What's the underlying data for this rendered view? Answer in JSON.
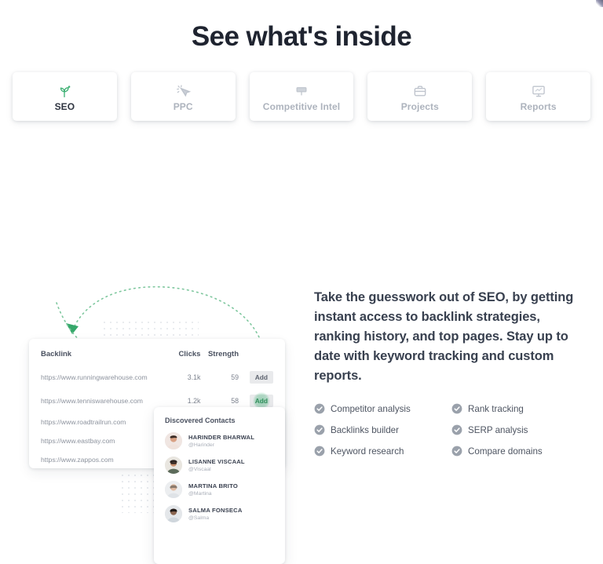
{
  "header": {
    "title": "See what's inside"
  },
  "tabs": [
    {
      "label": "SEO",
      "icon": "sprout-icon",
      "active": true
    },
    {
      "label": "PPC",
      "icon": "cursor-click-icon",
      "active": false
    },
    {
      "label": "Competitive Intel",
      "icon": "flag-icon",
      "active": false
    },
    {
      "label": "Projects",
      "icon": "briefcase-icon",
      "active": false
    },
    {
      "label": "Reports",
      "icon": "monitor-chart-icon",
      "active": false
    }
  ],
  "backlink_table": {
    "columns": [
      "Backlink",
      "Clicks",
      "Strength",
      ""
    ],
    "rows": [
      {
        "backlink": "https://www.runningwarehouse.com",
        "clicks": "3.1k",
        "strength": "59",
        "action": "Add",
        "action_state": "default"
      },
      {
        "backlink": "https://www.tenniswarehouse.com",
        "clicks": "1.2k",
        "strength": "58",
        "action": "Add",
        "action_state": "clicked"
      },
      {
        "backlink": "https://www.roadtrailrun.com",
        "clicks": "",
        "strength": "",
        "action": "",
        "action_state": "none"
      },
      {
        "backlink": "https://www.eastbay.com",
        "clicks": "",
        "strength": "",
        "action": "",
        "action_state": "none"
      },
      {
        "backlink": "https://www.zappos.com",
        "clicks": "",
        "strength": "",
        "action": "",
        "action_state": "none"
      }
    ]
  },
  "contacts_panel": {
    "title": "Discovered Contacts",
    "contacts": [
      {
        "name": "HARINDER BHARWAL",
        "handle": "@Harinder",
        "skin": "#d9a184",
        "hair": "#3a2b25",
        "shirt": "#efe2dc",
        "highlighted": false
      },
      {
        "name": "LISANNE VISCAAL",
        "handle": "@Viscaal",
        "skin": "#c98f6d",
        "hair": "#2c2320",
        "shirt": "#5c6b5a",
        "highlighted": false
      },
      {
        "name": "MARTINA BRITO",
        "handle": "@Martina",
        "skin": "#e2bda4",
        "hair": "#8a7a6c",
        "shirt": "#dfe3e7",
        "highlighted": true
      },
      {
        "name": "SALMA FONSECA",
        "handle": "@Salma",
        "skin": "#8a6550",
        "hair": "#211a17",
        "shirt": "#cfd6dc",
        "highlighted": false
      }
    ]
  },
  "promo": {
    "lead": "Take the guesswork out of SEO, by getting instant access to backlink strategies, ranking history, and top pages. Stay up to date with keyword tracking and custom reports.",
    "features": [
      "Competitor analysis",
      "Rank tracking",
      "Backlinks builder",
      "SERP analysis",
      "Keyword research",
      "Compare domains"
    ]
  },
  "colors": {
    "accent_green": "#3caf72",
    "arrow_green": "#35a86a",
    "title_dark": "#1f2430",
    "text_body": "#4e5562",
    "muted": "#a9aeb8",
    "check_grey": "#9aa1ab",
    "card_white": "#ffffff",
    "button_grey": "#e9eaec",
    "dot_grid": "#dfe2e8"
  }
}
